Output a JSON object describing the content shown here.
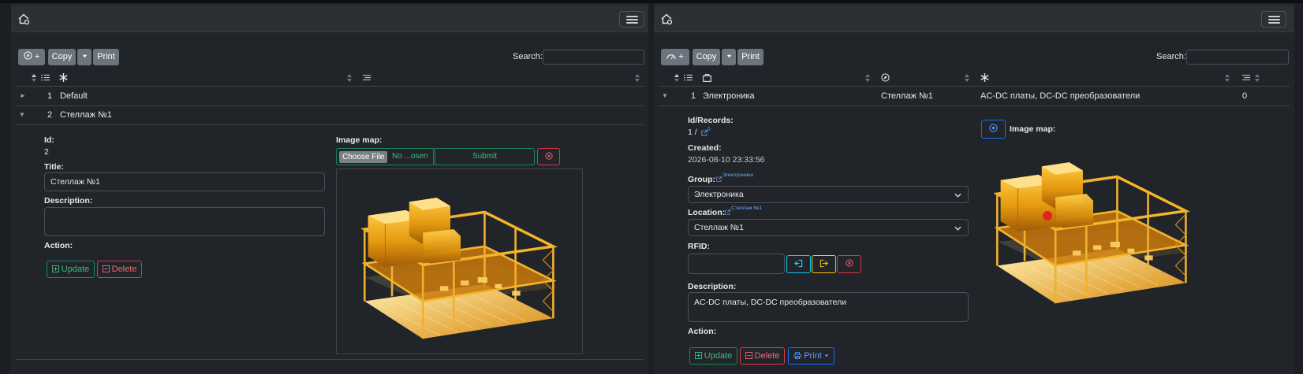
{
  "colors": {
    "background": "#1b1e22",
    "panel": "#212529",
    "navbar": "#2b3035",
    "secondary_button": "#6c757d",
    "success": "#198754",
    "danger": "#dc3545",
    "primary": "#0d6efd",
    "warehouse_glow": "#ffc107"
  },
  "icons": {
    "home": "home-gear-icon",
    "menu": "hamburger-menu-icon",
    "add_location": "compass-plus-icon",
    "add_item": "dashboard-plus-icon",
    "asterisk": "asterisk-icon",
    "sort": "sort-arrows-icon",
    "list": "list-icon",
    "box": "box-icon",
    "compass": "compass-icon",
    "external_link": "external-link-icon",
    "locate": "target-icon",
    "rfid_in": "rfid-in-icon",
    "rfid_out": "rfid-out-icon",
    "clear": "x-circle-icon",
    "update": "plus-square-icon",
    "delete": "minus-square-icon",
    "printer": "printer-icon"
  },
  "left": {
    "toolbar": {
      "add_label": "+",
      "copy_label": "Copy",
      "print_label": "Print"
    },
    "search": {
      "label": "Search:",
      "value": ""
    },
    "table": {
      "rows": [
        {
          "toggle": "►",
          "num": "1",
          "title": "Default"
        },
        {
          "toggle": "▼",
          "num": "2",
          "title": "Стеллаж №1"
        }
      ]
    },
    "detail": {
      "id_label": "Id:",
      "id_value": "2",
      "title_label": "Title:",
      "title_value": "Стеллаж №1",
      "description_label": "Description:",
      "description_value": "",
      "action_label": "Action:",
      "update_label": "Update",
      "delete_label": "Delete",
      "image_map_label": "Image map:",
      "choose_file_label": "Choose File",
      "no_file_label": "No ...osen",
      "submit_label": "Submit"
    }
  },
  "right": {
    "toolbar": {
      "add_label": "+",
      "copy_label": "Copy",
      "print_label": "Print"
    },
    "search": {
      "label": "Search:",
      "value": ""
    },
    "table": {
      "rows": [
        {
          "toggle": "▼",
          "num": "1",
          "group": "Электроника",
          "location": "Стеллаж №1",
          "description": "AC-DC платы, DC-DC преобразователи",
          "count": "0"
        }
      ]
    },
    "detail": {
      "id_records_label": "Id/Records:",
      "id_records_value": "1 /",
      "records_link_count": "0",
      "created_label": "Created:",
      "created_value": "2026-08-10 23:33:56",
      "group_label": "Group:",
      "group_link": "Электроника",
      "group_value": "Электроника",
      "location_label": "Location:",
      "location_link": "Стеллаж №1",
      "location_value": "Стеллаж №1",
      "rfid_label": "RFID:",
      "rfid_value": "",
      "description_label": "Description:",
      "description_value": "AC-DC платы, DC-DC преобразователи",
      "action_label": "Action:",
      "update_label": "Update",
      "delete_label": "Delete",
      "print_label": "Print",
      "image_map_label": "Image map:"
    }
  }
}
